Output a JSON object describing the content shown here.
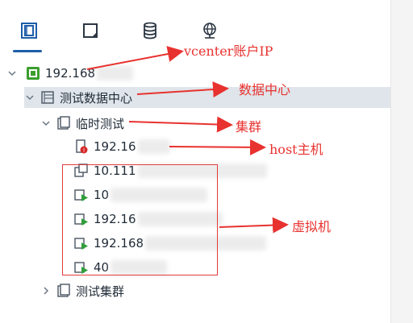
{
  "toolbar": {
    "tabs": [
      {
        "name": "hosts-and-clusters",
        "icon": "hosts-clusters-icon"
      },
      {
        "name": "vms-and-templates",
        "icon": "vm-template-icon"
      },
      {
        "name": "storage",
        "icon": "database-icon"
      },
      {
        "name": "networking",
        "icon": "network-globe-icon"
      }
    ],
    "active_index": 0
  },
  "tree": {
    "vcenter": {
      "label": "192.168",
      "icon": "vcenter-icon"
    },
    "datacenter": {
      "label": "测试数据中心",
      "icon": "datacenter-icon"
    },
    "cluster1": {
      "label": "临时测试",
      "icon": "cluster-icon"
    },
    "host": {
      "label": "192.16",
      "icon": "host-error-icon"
    },
    "vms": [
      {
        "label": "10.111",
        "icon": "vm-off-icon"
      },
      {
        "label": "10",
        "icon": "vm-running-icon"
      },
      {
        "label": "192.16",
        "icon": "vm-running-icon"
      },
      {
        "label": "192.168",
        "icon": "vm-running-icon"
      },
      {
        "label": "40",
        "icon": "vm-running-icon"
      }
    ],
    "cluster2": {
      "label": "测试集群",
      "icon": "cluster-icon"
    }
  },
  "annotations": {
    "vcenter": "vcenter账户IP",
    "datacenter": "数据中心",
    "cluster": "集群",
    "host": "host主机",
    "vm": "虚拟机"
  },
  "colors": {
    "accent": "#1f5ea8",
    "annotation": "#e8322f",
    "selected_bg": "#dfe5ea",
    "vcenter_green": "#3b9e2e"
  }
}
